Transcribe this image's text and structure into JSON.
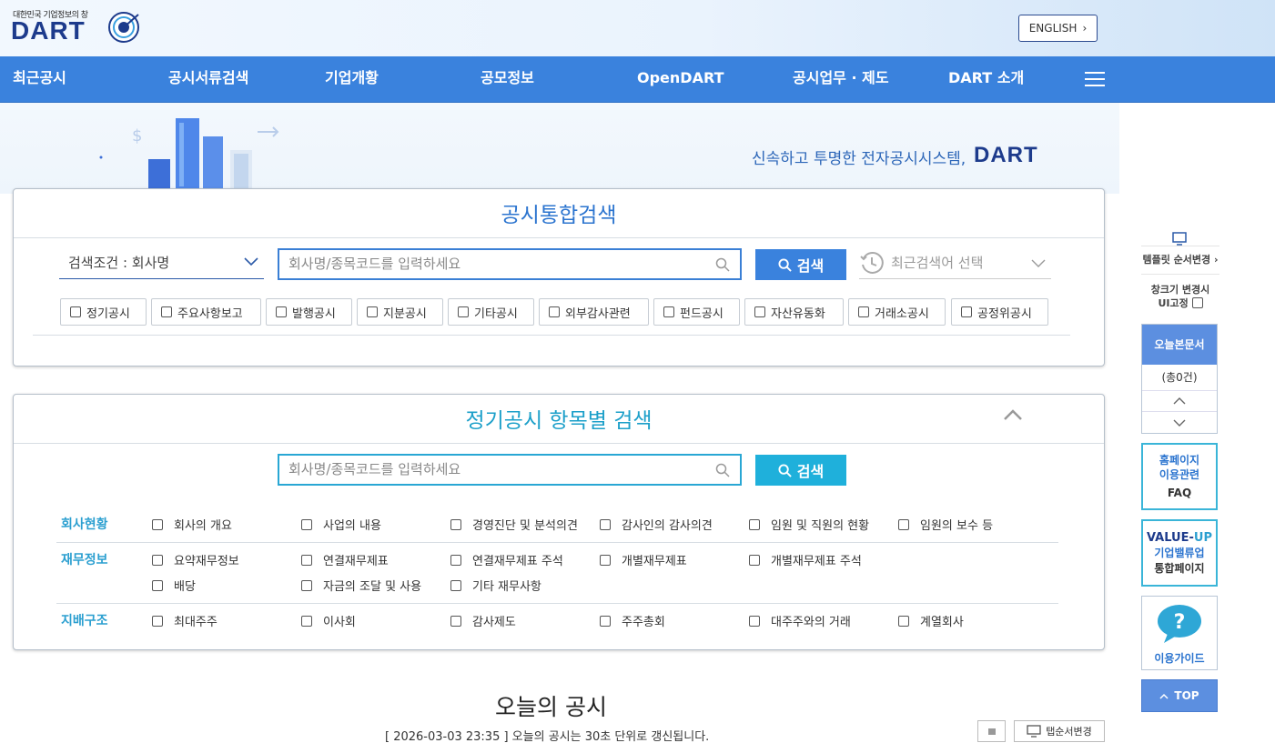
{
  "header": {
    "logo_subtitle": "대한민국 기업정보의 창",
    "logo_text": "DART",
    "english_button": "ENGLISH"
  },
  "nav": {
    "items": [
      "최근공시",
      "공시서류검색",
      "기업개황",
      "공모정보",
      "OpenDART",
      "공시업무 · 제도",
      "DART 소개"
    ]
  },
  "banner": {
    "slogan": "신속하고 투명한 전자공시시스템,",
    "slogan_brand": "DART"
  },
  "integrated_search": {
    "title": "공시통합검색",
    "condition_label": "검색조건 : 회사명",
    "input_placeholder": "회사명/종목코드를 입력하세요",
    "search_button": "검색",
    "recent_label": "최근검색어 선택",
    "checkboxes": [
      "정기공시",
      "주요사항보고",
      "발행공시",
      "지분공시",
      "기타공시",
      "외부감사관련",
      "펀드공시",
      "자산유동화",
      "거래소공시",
      "공정위공시"
    ]
  },
  "periodic_search": {
    "title": "정기공시 항목별 검색",
    "input_placeholder": "회사명/종목코드를 입력하세요",
    "search_button": "검색",
    "rows": [
      {
        "label": "회사현황",
        "items": [
          "회사의 개요",
          "사업의 내용",
          "경영진단 및 분석의견",
          "감사인의 감사의견",
          "임원 및 직원의 현황",
          "임원의 보수 등"
        ]
      },
      {
        "label": "재무정보",
        "items": [
          "요약재무정보",
          "연결재무제표",
          "연결재무제표 주석",
          "개별재무제표",
          "개별재무제표 주석",
          "배당",
          "자금의 조달 및 사용",
          "기타 재무사항"
        ]
      },
      {
        "label": "지배구조",
        "items": [
          "최대주주",
          "이사회",
          "감사제도",
          "주주총회",
          "대주주와의 거래",
          "계열회사"
        ]
      }
    ]
  },
  "today": {
    "title": "오늘의 공시",
    "subtitle": "[ 2026-03-03 23:35 ] 오늘의 공시는 30초 단위로 갱신됩니다.",
    "tab_order_button": "탭순서변경"
  },
  "sidebar": {
    "template_label": "템플릿 순서변경",
    "fixed_ui_line1": "창크기 변경시",
    "fixed_ui_line2": "UI고정",
    "today_docs_title": "오늘본문서",
    "today_docs_count": "(총0건)",
    "homepage_line1": "홈페이지",
    "homepage_line2": "이용관련",
    "homepage_line3": "FAQ",
    "valueup_line1a": "VALUE-",
    "valueup_line1b": "UP",
    "valueup_line2": "기업밸류업",
    "valueup_line3": "통합페이지",
    "guide_label": "이용가이드",
    "top_button": "TOP"
  },
  "colors": {
    "nav_bg": "#3a82dd",
    "brand_navy": "#1d3b8c",
    "accent_blue": "#2b74cf",
    "accent_cyan": "#1b9fc9"
  }
}
